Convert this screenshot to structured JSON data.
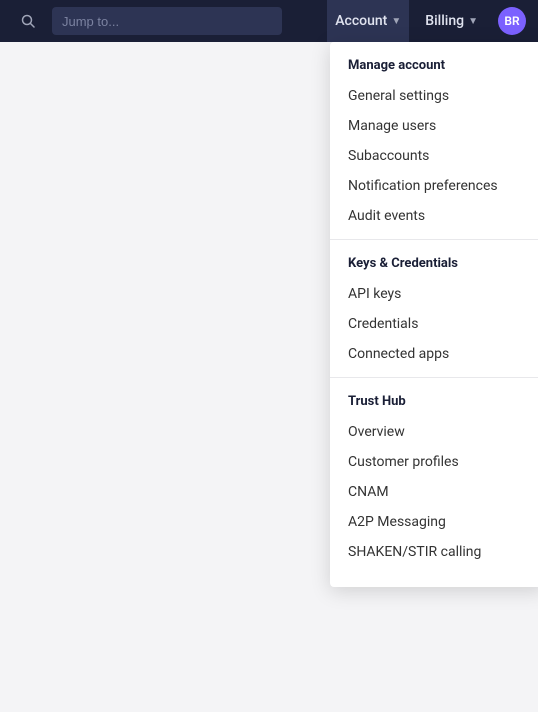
{
  "navbar": {
    "search_placeholder": "Jump to...",
    "account_label": "Account",
    "billing_label": "Billing",
    "avatar_initials": "BR"
  },
  "dropdown": {
    "sections": [
      {
        "id": "manage_account",
        "title": "Manage account",
        "items": [
          {
            "id": "general_settings",
            "label": "General settings"
          },
          {
            "id": "manage_users",
            "label": "Manage users"
          },
          {
            "id": "subaccounts",
            "label": "Subaccounts"
          },
          {
            "id": "notification_preferences",
            "label": "Notification preferences"
          },
          {
            "id": "audit_events",
            "label": "Audit events"
          }
        ]
      },
      {
        "id": "keys_credentials",
        "title": "Keys & Credentials",
        "items": [
          {
            "id": "api_keys",
            "label": "API keys"
          },
          {
            "id": "credentials",
            "label": "Credentials"
          },
          {
            "id": "connected_apps",
            "label": "Connected apps"
          }
        ]
      },
      {
        "id": "trust_hub",
        "title": "Trust Hub",
        "items": [
          {
            "id": "overview",
            "label": "Overview"
          },
          {
            "id": "customer_profiles",
            "label": "Customer profiles"
          },
          {
            "id": "cnam",
            "label": "CNAM"
          },
          {
            "id": "a2p_messaging",
            "label": "A2P Messaging"
          },
          {
            "id": "shaken_stir",
            "label": "SHAKEN/STIR calling"
          }
        ]
      }
    ]
  }
}
